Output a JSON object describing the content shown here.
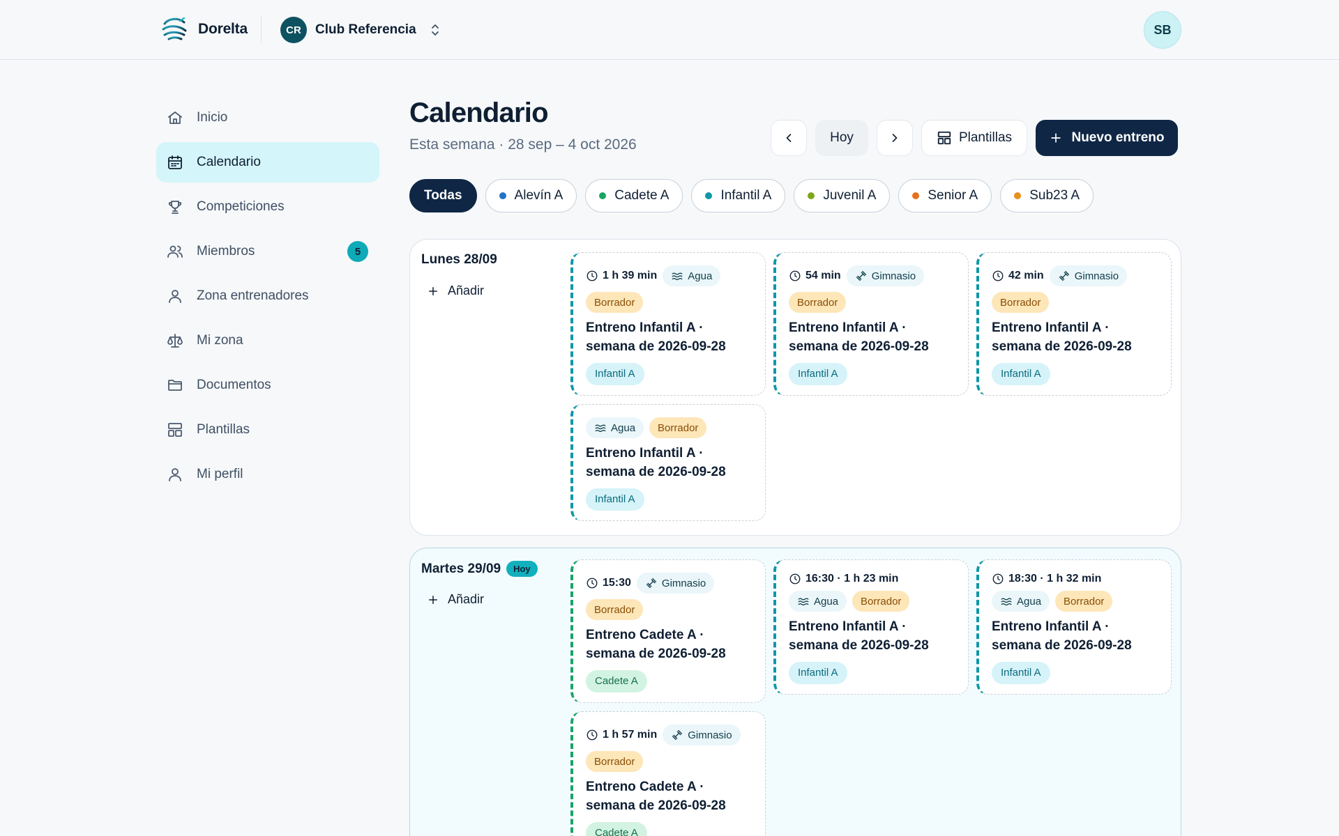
{
  "app": {
    "brand": "Dorelta",
    "club_initials": "CR",
    "club_name": "Club Referencia",
    "user_initials": "SB"
  },
  "sidebar": {
    "items": [
      {
        "label": "Inicio",
        "icon": "home-icon"
      },
      {
        "label": "Calendario",
        "icon": "calendar-icon",
        "active": true
      },
      {
        "label": "Competiciones",
        "icon": "trophy-icon"
      },
      {
        "label": "Miembros",
        "icon": "users-icon",
        "badge": "5"
      },
      {
        "label": "Zona entrenadores",
        "icon": "coach-icon"
      },
      {
        "label": "Mi zona",
        "icon": "scale-icon"
      },
      {
        "label": "Documentos",
        "icon": "folder-icon"
      },
      {
        "label": "Plantillas",
        "icon": "layout-icon"
      },
      {
        "label": "Mi perfil",
        "icon": "user-icon"
      }
    ]
  },
  "header": {
    "title": "Calendario",
    "subtitle": "Esta semana · 28 sep – 4 oct 2026",
    "today_label": "Hoy",
    "templates_label": "Plantillas",
    "new_label": "Nuevo entreno"
  },
  "filters": [
    {
      "label": "Todas",
      "active": true
    },
    {
      "label": "Alevín A",
      "color": "#1e73c8"
    },
    {
      "label": "Cadete A",
      "color": "#19a463"
    },
    {
      "label": "Infantil A",
      "color": "#0e97a6"
    },
    {
      "label": "Juvenil A",
      "color": "#7ea61a"
    },
    {
      "label": "Senior A",
      "color": "#e8701a"
    },
    {
      "label": "Sub23 A",
      "color": "#e8901a"
    }
  ],
  "colors": {
    "accent": "#0f2745",
    "today": "#12b0bd",
    "draft_bg": "#fde6b8",
    "infantil": "#0e97a6",
    "cadete": "#19a463"
  },
  "days": [
    {
      "label": "Lunes 28/09",
      "add_label": "Añadir",
      "cards": [
        {
          "meta": "1 h 39 min",
          "location": "Agua",
          "status": "Borrador",
          "title": "Entreno Infantil A · semana de 2026-09-28",
          "team": "Infantil A"
        },
        {
          "meta": "54 min",
          "location": "Gimnasio",
          "status": "Borrador",
          "title": "Entreno Infantil A · semana de 2026-09-28",
          "team": "Infantil A"
        },
        {
          "meta": "42 min",
          "location": "Gimnasio",
          "status": "Borrador",
          "title": "Entreno Infantil A · semana de 2026-09-28",
          "team": "Infantil A"
        },
        {
          "location": "Agua",
          "status": "Borrador",
          "title": "Entreno Infantil A · semana de 2026-09-28",
          "team": "Infantil A"
        }
      ]
    },
    {
      "label": "Martes 29/09",
      "today_badge": "Hoy",
      "add_label": "Añadir",
      "cards": [
        {
          "meta": "15:30",
          "location": "Gimnasio",
          "status": "Borrador",
          "title": "Entreno Cadete A · semana de 2026-09-28",
          "team": "Cadete A"
        },
        {
          "meta": "16:30 · 1 h 23 min",
          "location": "Agua",
          "status": "Borrador",
          "title": "Entreno Infantil A · semana de 2026-09-28",
          "team": "Infantil A"
        },
        {
          "meta": "18:30 · 1 h 32 min",
          "location": "Agua",
          "status": "Borrador",
          "title": "Entreno Infantil A · semana de 2026-09-28",
          "team": "Infantil A"
        },
        {
          "meta": "1 h 57 min",
          "location": "Gimnasio",
          "status": "Borrador",
          "title": "Entreno Cadete A · semana de 2026-09-28",
          "team": "Cadete A"
        }
      ]
    }
  ]
}
